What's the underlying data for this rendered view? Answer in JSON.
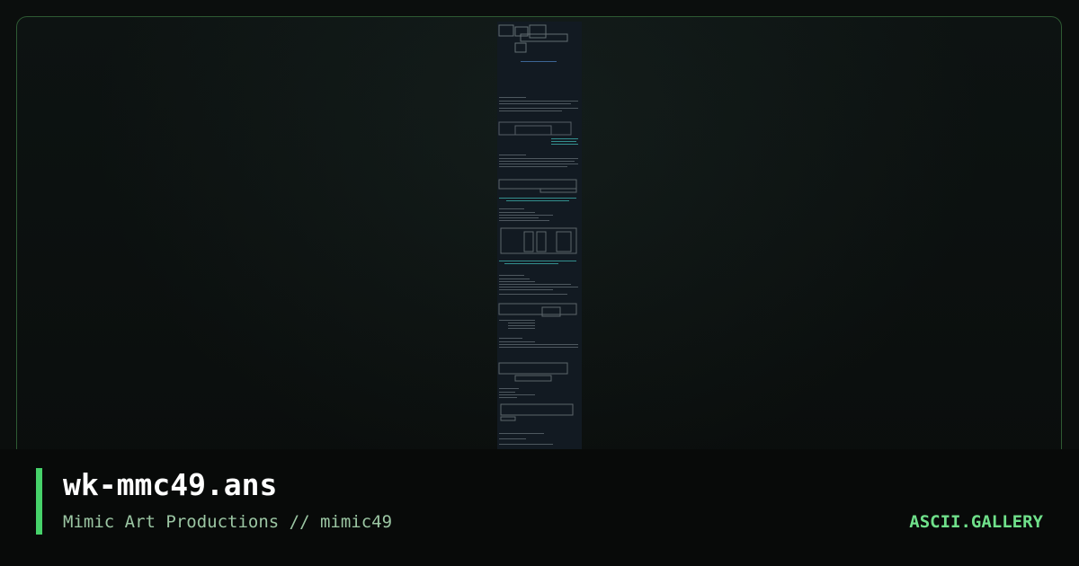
{
  "artwork": {
    "filename": "wk-mmc49.ans",
    "credit": "Mimic Art Productions // mimic49"
  },
  "site": {
    "brand": "ASCII.GALLERY"
  },
  "colors": {
    "accent": "#46d26a",
    "brand_text": "#6fe08a",
    "border": "#2e5a33",
    "preview_background": "#121a22"
  }
}
